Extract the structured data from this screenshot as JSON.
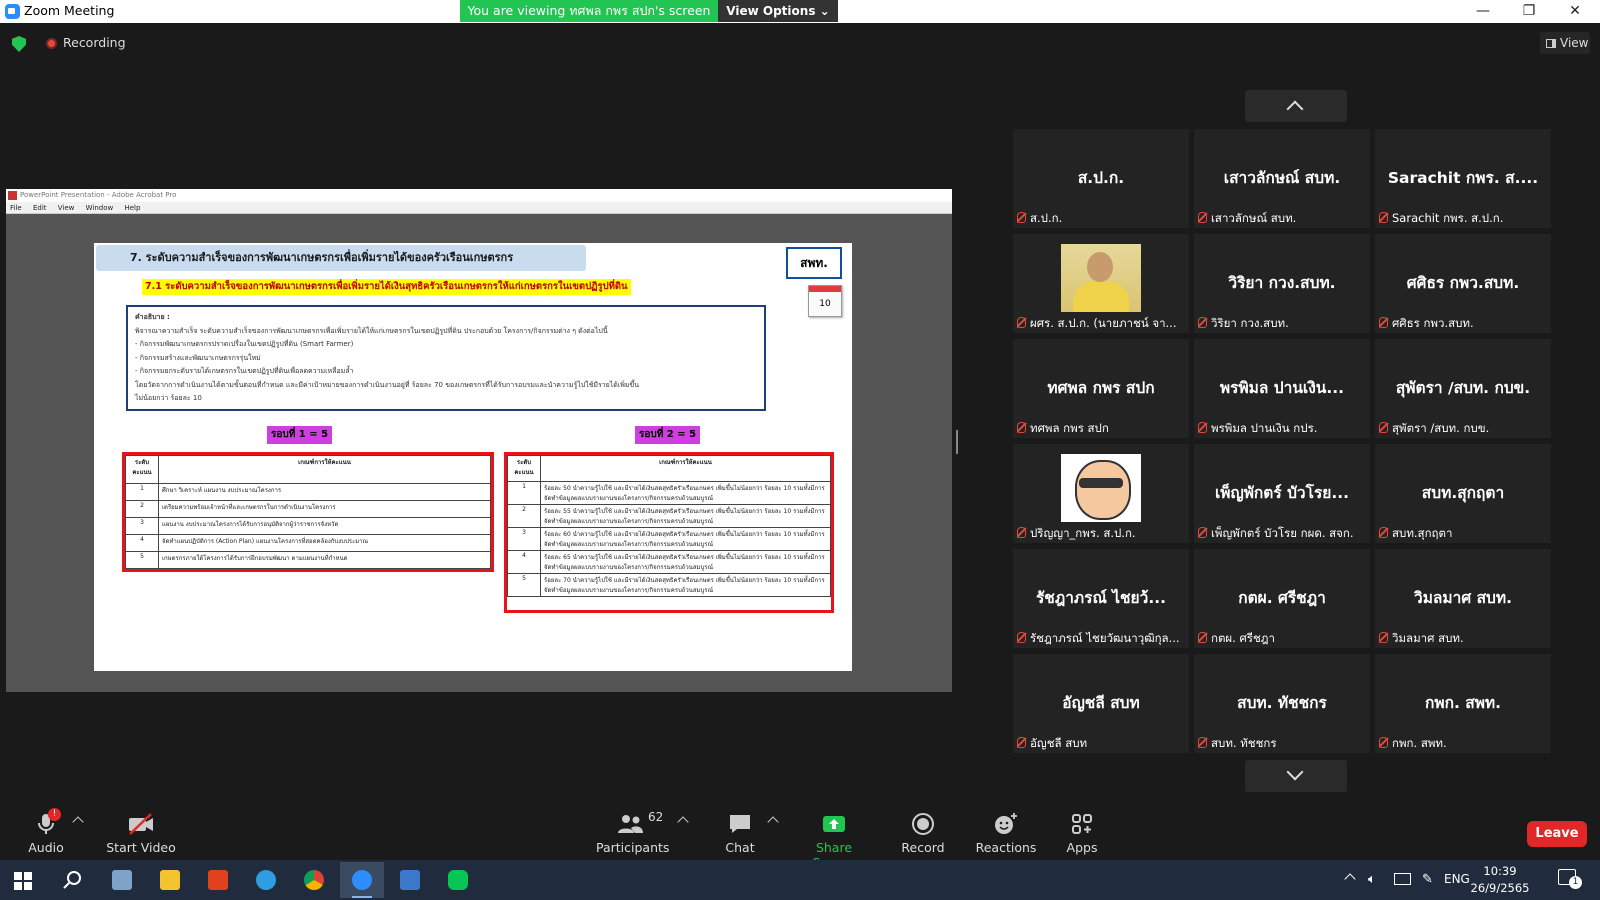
{
  "window": {
    "title": "Zoom Meeting",
    "viewing_banner": "You are viewing ทศพล กพร สปก's screen",
    "view_options": "View Options ⌄",
    "controls": [
      "—",
      "❐",
      "✕"
    ]
  },
  "toolbar": {
    "recording_label": "Recording",
    "view_label": "View"
  },
  "shared_screen": {
    "app_title": "PowerPoint Presentation - Adobe Acrobat Pro",
    "menu": [
      "File",
      "Edit",
      "View",
      "Window",
      "Help"
    ],
    "slide": {
      "header": "7. ระดับความสำเร็จของการพัฒนาเกษตรกรเพื่อเพิ่มรายได้ของครัวเรือนเกษตรกร",
      "org": "สพท.",
      "calendar": "10",
      "subheader": "7.1 ระดับความสำเร็จของการพัฒนาเกษตรกรเพื่อเพิ่มรายได้เงินสุทธิครัวเรือนเกษตรกรให้แก่เกษตรกรในเขตปฏิรูปที่ดิน",
      "desc_title": "คำอธิบาย :",
      "desc_lines": [
        "พิจารณาความสำเร็จ ระดับความสำเร็จของการพัฒนาเกษตรกรเพื่อเพิ่มรายได้ให้แก่เกษตรกรในเขตปฏิรูปที่ดิน ประกอบด้วย โครงการ/กิจกรรมต่าง ๆ ดังต่อไปนี้",
        "- กิจกรรมพัฒนาเกษตรกรปราดเปรื่องในเขตปฏิรูปที่ดิน (Smart Farmer)",
        "- กิจกรรมสร้างและพัฒนาเกษตรกรรุ่นใหม่",
        "- กิจกรรมยกระดับรายได้เกษตรกรในเขตปฏิรูปที่ดินเพื่อลดความเหลื่อมล้ำ",
        "โดยวัดจากการดำเนินงานได้ตามขั้นตอนที่กำหนด และมีค่าเป้าหมายของการดำเนินงานอยู่ที่ ร้อยละ 70 ของเกษตรกรที่ได้รับการอบรมและนำความรู้ไปใช้มีรายได้เพิ่มขึ้น",
        "ไม่น้อยกว่า ร้อยละ 10"
      ],
      "round1": "รอบที่ 1 = 5",
      "round2": "รอบที่ 2 = 5",
      "table_head": [
        "ระดับคะแนน",
        "เกณฑ์การให้คะแนน"
      ],
      "table1": [
        [
          "1",
          "ศึกษา วิเคราะห์ แผนงาน งบประมาณโครงการ"
        ],
        [
          "2",
          "เตรียมความพร้อมเจ้าหน้าที่และเกษตรกรในการดำเนินงานโครงการ"
        ],
        [
          "3",
          "แผนงาน งบประมาณโครงการได้รับการอนุมัติจากผู้ว่าราชการจังหวัด"
        ],
        [
          "4",
          "จัดทำแผนปฏิบัติการ (Action Plan) แผนงานโครงการที่สอดคล้องกับงบประมาณ"
        ],
        [
          "5",
          "เกษตรกรภายใต้โครงการได้รับการฝึกอบรมพัฒนา ตามแผนงานที่กำหนด"
        ]
      ],
      "table2": [
        [
          "1",
          "ร้อยละ 50 นำความรู้ไปใช้ และมีรายได้เงินสดสุทธิครัวเรือนเกษตร เพิ่มขึ้นไม่น้อยกว่า ร้อยละ 10 รวมทั้งมีการจัดทำข้อมูลผลแบบรายงานของโครงการ/กิจกรรมครบถ้วนสมบูรณ์"
        ],
        [
          "2",
          "ร้อยละ 55 นำความรู้ไปใช้ และมีรายได้เงินสดสุทธิครัวเรือนเกษตร เพิ่มขึ้นไม่น้อยกว่า ร้อยละ 10 รวมทั้งมีการจัดทำข้อมูลผลแบบรายงานของโครงการ/กิจกรรมครบถ้วนสมบูรณ์"
        ],
        [
          "3",
          "ร้อยละ 60 นำความรู้ไปใช้ และมีรายได้เงินสดสุทธิครัวเรือนเกษตร เพิ่มขึ้นไม่น้อยกว่า ร้อยละ 10 รวมทั้งมีการจัดทำข้อมูลผลแบบรายงานของโครงการ/กิจกรรมครบถ้วนสมบูรณ์"
        ],
        [
          "4",
          "ร้อยละ 65 นำความรู้ไปใช้ และมีรายได้เงินสดสุทธิครัวเรือนเกษตร เพิ่มขึ้นไม่น้อยกว่า ร้อยละ 10 รวมทั้งมีการจัดทำข้อมูลผลแบบรายงานของโครงการ/กิจกรรมครบถ้วนสมบูรณ์"
        ],
        [
          "5",
          "ร้อยละ 70 นำความรู้ไปใช้ และมีรายได้เงินสดสุทธิครัวเรือนเกษตร เพิ่มขึ้นไม่น้อยกว่า ร้อยละ 10 รวมทั้งมีการจัดทำข้อมูลผลแบบรายงานของโครงการ/กิจกรรมครบถ้วนสมบูรณ์"
        ]
      ]
    }
  },
  "participants_gallery": [
    {
      "big": "ส.ป.ก.",
      "label": "ส.ป.ก."
    },
    {
      "big": "เสาวลักษณ์ สบท.",
      "label": "เสาวลักษณ์ สบท."
    },
    {
      "big": "Sarachit กพร. ส....",
      "label": "Sarachit กพร. ส.ป.ก."
    },
    {
      "big": "",
      "label": "ผศร. ส.ป.ก. (นายภาชน์ จา...",
      "photo": "person"
    },
    {
      "big": "วิริยา กวง.สบท.",
      "label": "วิริยา กวง.สบท."
    },
    {
      "big": "ศศิธร กพว.สบท.",
      "label": "ศศิธร กพว.สบท."
    },
    {
      "big": "ทศพล กพร สปก",
      "label": "ทศพล กพร สปก"
    },
    {
      "big": "พรพิมล ปานเงิน...",
      "label": "พรพิมล ปานเงิน กปร."
    },
    {
      "big": "สุพัตรา /สบท. กบข.",
      "label": "สุพัตรา /สบท. กบข."
    },
    {
      "big": "",
      "label": "ปริญญา_กพร. ส.ป.ก.",
      "photo": "cartoon"
    },
    {
      "big": "เพ็ญพักตร์ บัวโรย...",
      "label": "เพ็ญพักตร์ บัวโรย กผด. สจก."
    },
    {
      "big": "สบท.สุกฤตา",
      "label": "สบท.สุกฤตา"
    },
    {
      "big": "รัชฎาภรณ์ ไชยว้...",
      "label": "รัชฎาภรณ์ ไชยวัฒนาวุฒิกุล..."
    },
    {
      "big": "กตผ. ศรีชฎา",
      "label": "กตผ. ศรีชฎา"
    },
    {
      "big": "วิมลมาศ สบท.",
      "label": "วิมลมาศ สบท."
    },
    {
      "big": "อัญชลี สบท",
      "label": "อัญชลี สบท"
    },
    {
      "big": "สบท. ทัชชกร",
      "label": "สบท. ทัชชกร"
    },
    {
      "big": "กพก. สพท.",
      "label": "กพก. สพท."
    }
  ],
  "controls": {
    "audio": "Audio",
    "audio_badge": "!",
    "start_video": "Start Video",
    "participants": "Participants",
    "participants_count": "62",
    "chat": "Chat",
    "share_screen": "Share Screen",
    "record": "Record",
    "reactions": "Reactions",
    "apps": "Apps",
    "leave": "Leave"
  },
  "taskbar": {
    "lang": "ENG",
    "time": "10:39",
    "date": "26/9/2565",
    "notifications": "1"
  },
  "colors": {
    "banner_green": "#23c552",
    "leave_red": "#e02828",
    "share_green": "#23c552",
    "muted_red": "#e24a3b"
  }
}
